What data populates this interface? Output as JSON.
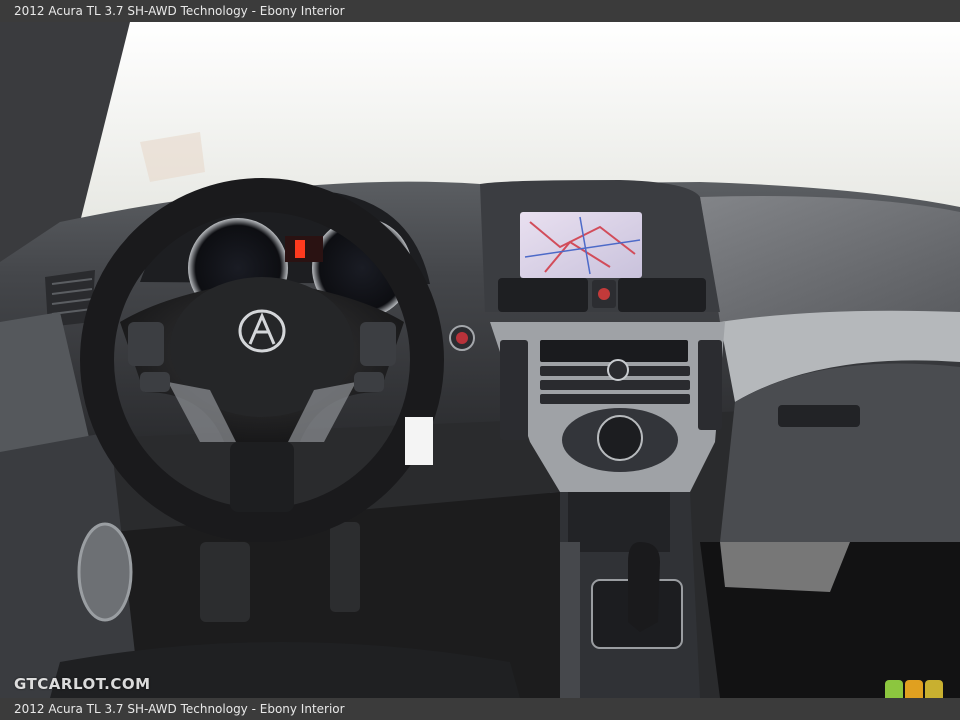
{
  "caption": {
    "top_text": "2012 Acura TL 3.7 SH-AWD Technology - Ebony Interior",
    "bottom_text": "2012 Acura TL 3.7 SH-AWD Technology - Ebony Interior"
  },
  "watermark": {
    "text": "GTCARLOT.COM"
  },
  "logo": {
    "colors": [
      "#8cc63f",
      "#e0a020",
      "#c8b030"
    ]
  },
  "photo": {
    "subject": "car-dashboard-interior",
    "colors": {
      "windshield": "#f2f3f1",
      "dashboard": "#3f4144",
      "dash_light": "#8a8d90",
      "steering": "#1c1c1e",
      "trim": "#a9acb0",
      "floor": "#141414"
    }
  }
}
